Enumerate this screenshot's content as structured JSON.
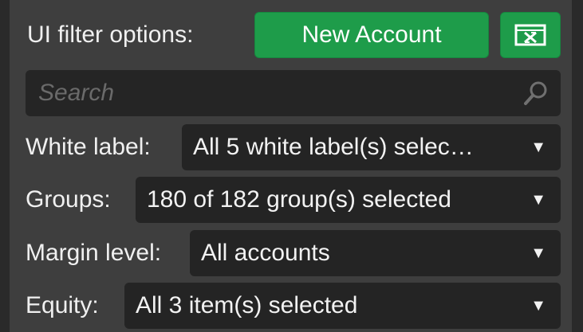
{
  "header": {
    "label": "UI filter options:",
    "new_account_label": "New Account",
    "export_icon": "excel-icon"
  },
  "search": {
    "placeholder": "Search",
    "value": "",
    "icon": "search-icon"
  },
  "filters": {
    "white_label": {
      "label": "White label:",
      "value": "All 5 white label(s) selec…"
    },
    "groups": {
      "label": "Groups:",
      "value": "180 of 182 group(s) selected"
    },
    "margin_level": {
      "label": "Margin level:",
      "value": "All accounts"
    },
    "equity": {
      "label": "Equity:",
      "value": "All 3 item(s) selected"
    }
  },
  "colors": {
    "accent": "#1e9c4a",
    "panel": "#3e3e3e",
    "field": "#242424"
  }
}
